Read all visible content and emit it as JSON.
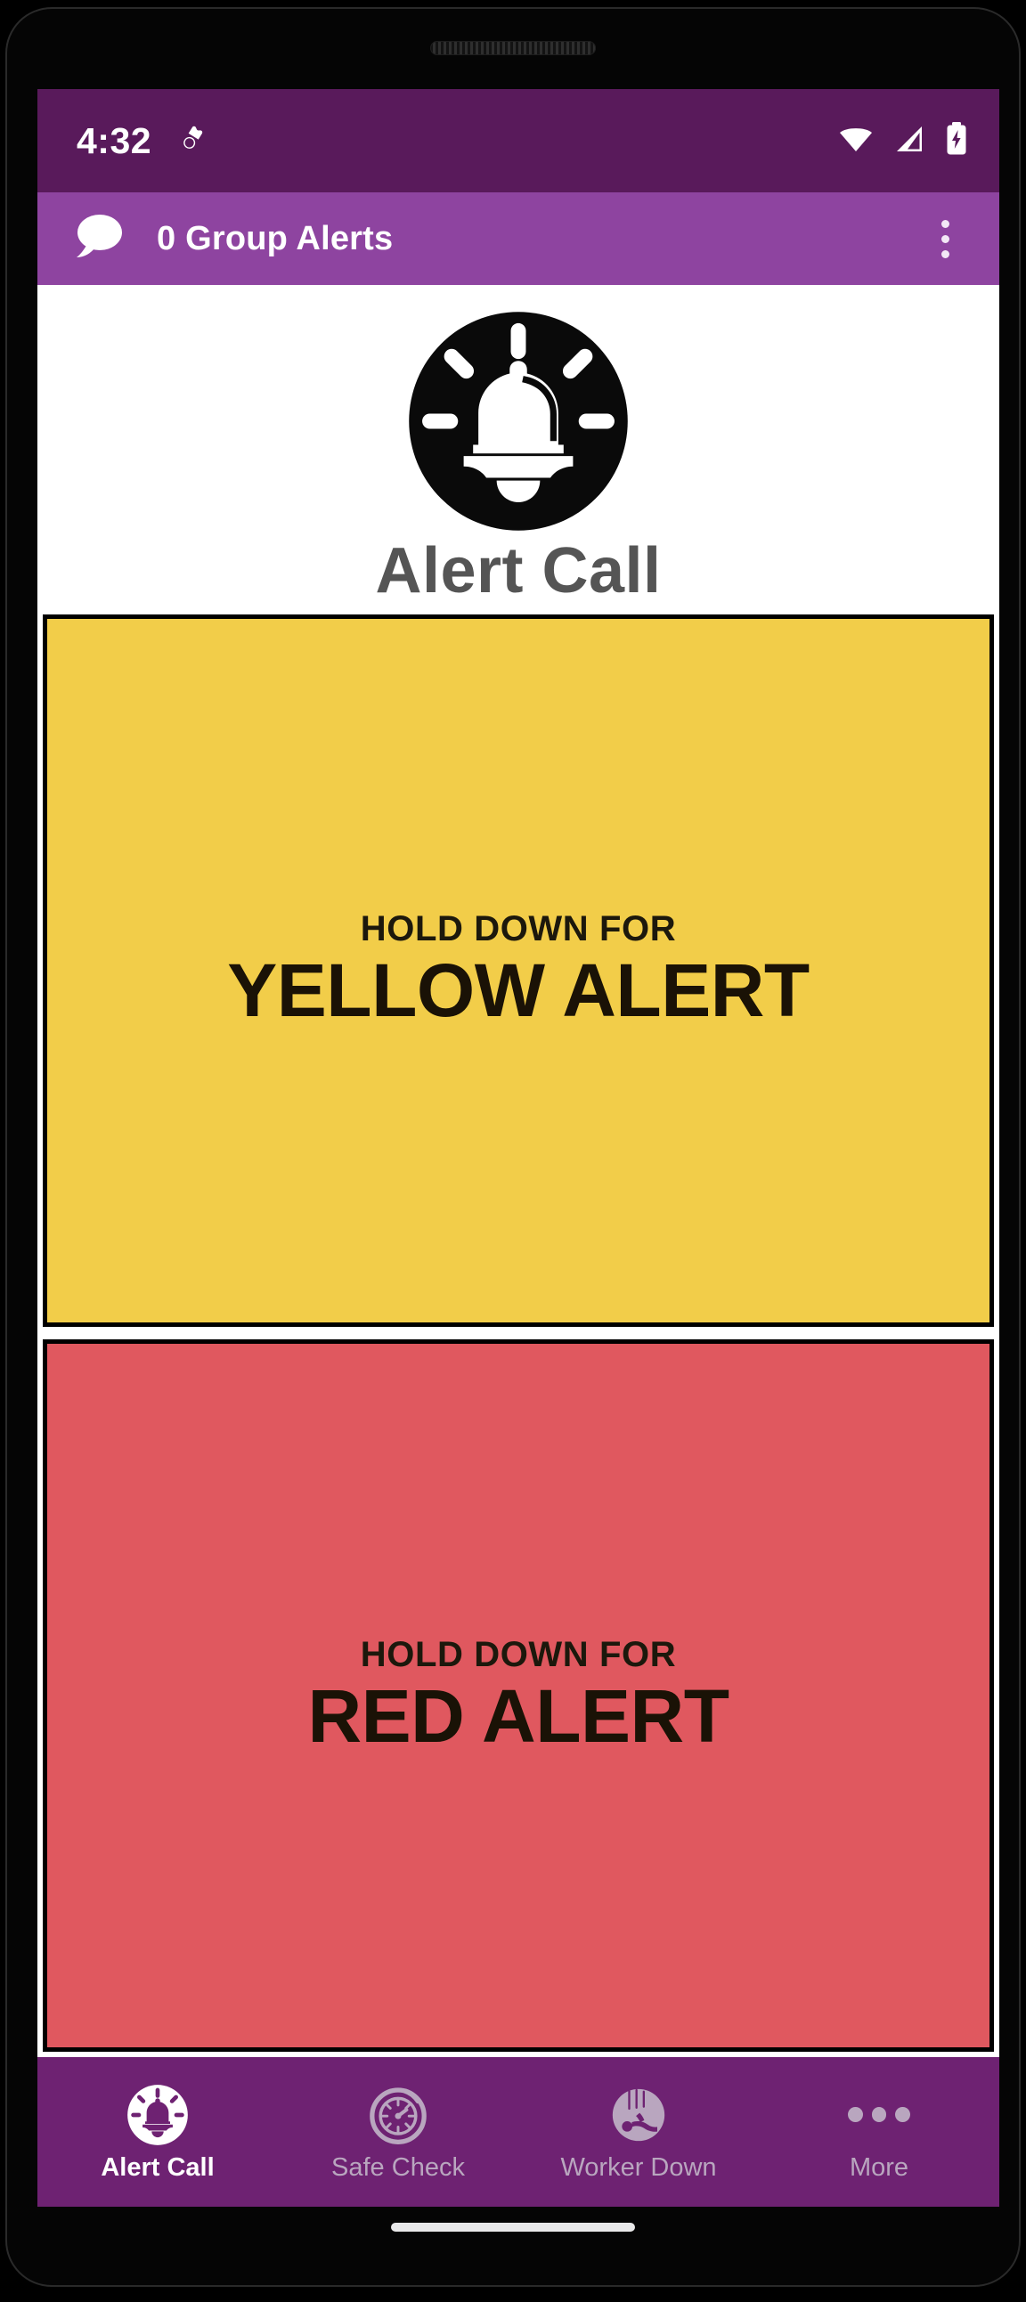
{
  "colors": {
    "status_bar_bg": "#591A5B",
    "app_bar_bg": "#8E44A0",
    "bottom_nav_bg": "#6E2272",
    "yellow_alert": "#F2CD49",
    "red_alert": "#E0585F",
    "brand_title": "#555555",
    "nav_inactive": "#b9a6bf",
    "nav_active": "#ffffff"
  },
  "status_bar": {
    "clock": "4:32",
    "left_icons": [
      "vibrate-icon"
    ],
    "right_icons": [
      "wifi-icon",
      "cellular-signal-icon",
      "battery-charging-icon"
    ]
  },
  "app_bar": {
    "icon": "speech-bubble-icon",
    "title": "0 Group Alerts",
    "overflow_menu": "more-vertical-icon"
  },
  "brand": {
    "logo": "alarm-bell-icon",
    "title": "Alert Call"
  },
  "alerts": [
    {
      "id": "yellow",
      "hold_label": "HOLD DOWN FOR",
      "name": "YELLOW ALERT",
      "bg": "#F2CD49"
    },
    {
      "id": "red",
      "hold_label": "HOLD DOWN FOR",
      "name": "RED ALERT",
      "bg": "#E0585F"
    }
  ],
  "bottom_nav": {
    "items": [
      {
        "label": "Alert Call",
        "icon": "alarm-bell-icon",
        "active": true
      },
      {
        "label": "Safe Check",
        "icon": "stopwatch-icon",
        "active": false
      },
      {
        "label": "Worker Down",
        "icon": "worker-down-icon",
        "active": false
      },
      {
        "label": "More",
        "icon": "more-dots-icon",
        "active": false
      }
    ]
  }
}
